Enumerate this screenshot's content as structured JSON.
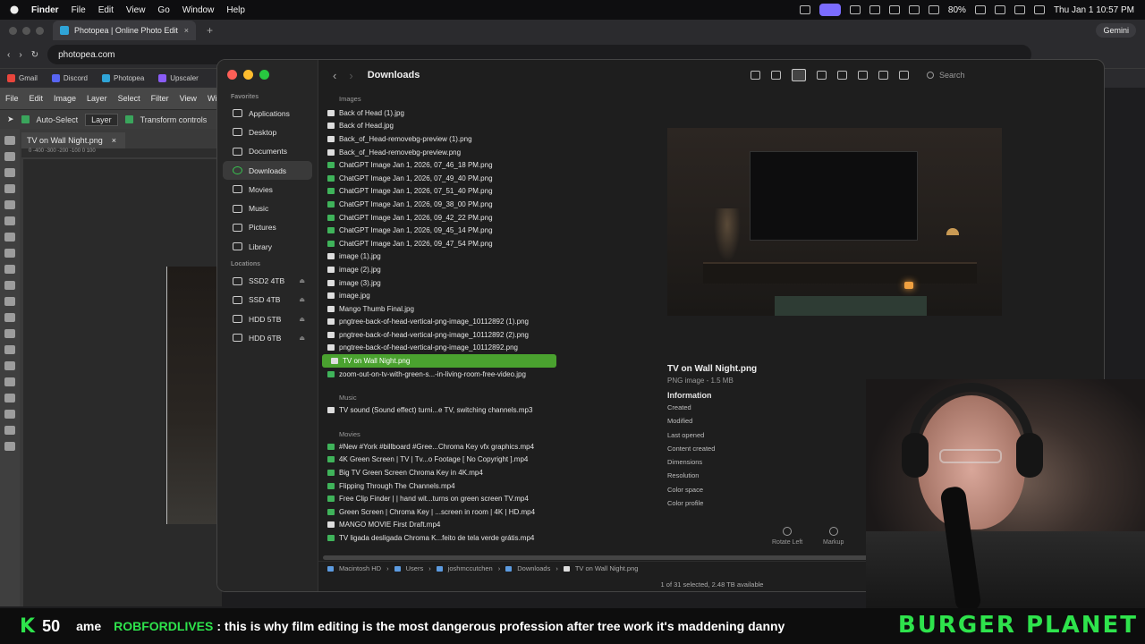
{
  "menubar": {
    "app": "Finder",
    "items": [
      "File",
      "Edit",
      "View",
      "Go",
      "Window",
      "Help"
    ],
    "battery": "80%",
    "datetime": "Thu Jan 1  10:57 PM"
  },
  "browser": {
    "tab_title": "Photopea | Online Photo Edit",
    "url": "photopea.com",
    "gemini": "Gemini",
    "bookmarks": [
      "Gmail",
      "Discord",
      "Photopea",
      "Upscaler"
    ]
  },
  "photopea": {
    "menu": [
      "File",
      "Edit",
      "Image",
      "Layer",
      "Select",
      "Filter",
      "View",
      "Win"
    ],
    "auto_select": "Auto-Select",
    "layer_select": "Layer",
    "transform": "Transform controls",
    "doc_tab": "TV on Wall Night.png",
    "ruler": "0   -400   -300   -200   -100   0   100"
  },
  "finder": {
    "title": "Downloads",
    "search_placeholder": "Search",
    "sidebar": {
      "favorites_label": "Favorites",
      "favorites": [
        "Applications",
        "Desktop",
        "Documents",
        "Downloads",
        "Movies",
        "Music",
        "Pictures",
        "Library"
      ],
      "locations_label": "Locations",
      "locations": [
        "SSD2 4TB",
        "SSD 4TB",
        "HDD 5TB",
        "HDD 6TB"
      ]
    },
    "groups": [
      {
        "label": "Images",
        "files": [
          "Back of Head (1).jpg",
          "Back of Head.jpg",
          "Back_of_Head-removebg-preview (1).png",
          "Back_of_Head-removebg-preview.png",
          "ChatGPT Image Jan 1, 2026, 07_46_18 PM.png",
          "ChatGPT Image Jan 1, 2026, 07_49_40 PM.png",
          "ChatGPT Image Jan 1, 2026, 07_51_40 PM.png",
          "ChatGPT Image Jan 1, 2026, 09_38_00 PM.png",
          "ChatGPT Image Jan 1, 2026, 09_42_22 PM.png",
          "ChatGPT Image Jan 1, 2026, 09_45_14 PM.png",
          "ChatGPT Image Jan 1, 2026, 09_47_54 PM.png",
          "image (1).jpg",
          "image (2).jpg",
          "image (3).jpg",
          "image.jpg",
          "Mango Thumb Final.jpg",
          "pngtree-back-of-head-vertical-png-image_10112892 (1).png",
          "pngtree-back-of-head-vertical-png-image_10112892 (2).png",
          "pngtree-back-of-head-vertical-png-image_10112892.png",
          "TV on Wall Night.png",
          "zoom-out-on-tv-with-green-s...-in-living-room-free-video.jpg"
        ]
      },
      {
        "label": "Music",
        "files": [
          "TV sound (Sound effect) turni...e TV, switching channels.mp3"
        ]
      },
      {
        "label": "Movies",
        "files": [
          "#New #York #billboard #Gree...Chroma Key vfx graphics.mp4",
          "4K Green Screen  |  TV  |  Tv...o Footage [ No Copyright ].mp4",
          "Big TV Green Screen Chroma Key in 4K.mp4",
          "Flipping Through The Channels.mp4",
          "Free Clip  Finder  |  |  hand wit...turns on green screen TV.mp4",
          "Green Screen | Chroma Key | ...screen in room  | 4K | HD.mp4",
          "MANGO MOVIE First Draft.mp4",
          "TV ligada desligada Chroma K...feito de tela verde grátis.mp4"
        ]
      }
    ],
    "selected_file": "TV on Wall Night.png",
    "path": [
      "Macintosh HD",
      "Users",
      "joshmccutchen",
      "Downloads",
      "TV on Wall Night.png"
    ],
    "status": "1 of 31 selected, 2.48 TB available",
    "preview": {
      "name": "TV on Wall Night.png",
      "kind": "PNG image - 1.5 MB",
      "info_label": "Information",
      "fields": [
        "Created",
        "Modified",
        "Last opened",
        "Content created",
        "Dimensions",
        "Resolution",
        "Color space",
        "Color profile"
      ],
      "actions": [
        "Rotate Left",
        "Markup"
      ]
    }
  },
  "ticker": {
    "k": "K",
    "count": "50",
    "prefix": "ame",
    "user": "ROBFORDLIVES",
    "message": ": this is why film editing is the most dangerous profession after tree work it's maddening danny",
    "brand": "BURGER PLANET"
  },
  "colors": {
    "selection": "#4aa22f",
    "accent_green": "#2ee34c",
    "folder_blue": "#5c9be0"
  }
}
